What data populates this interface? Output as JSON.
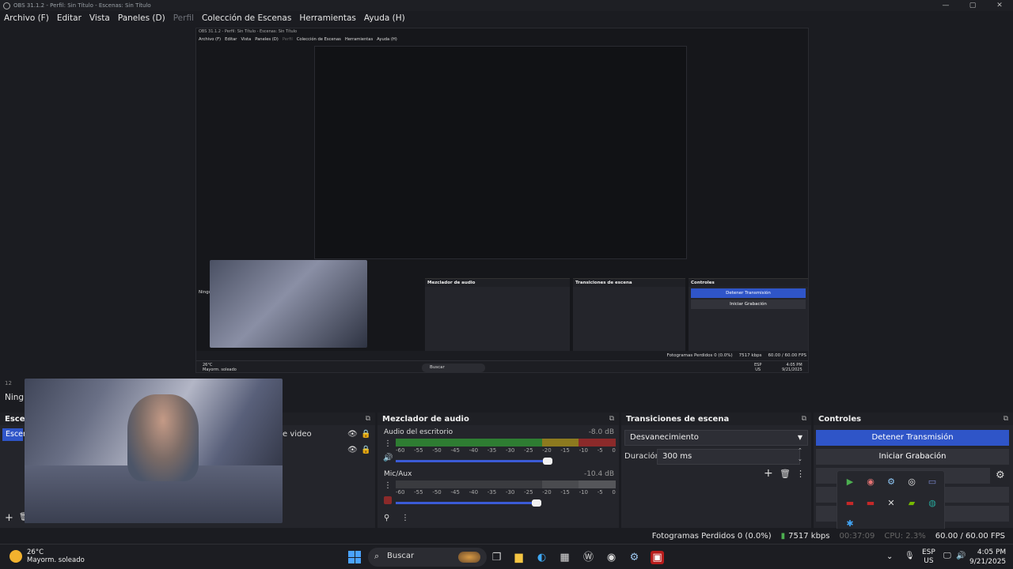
{
  "window": {
    "title": "OBS 31.1.2 - Perfil: Sin Título - Escenas: Sin Título",
    "controls": [
      "—",
      "▢",
      "✕"
    ]
  },
  "menu": [
    {
      "label": "Archivo (F)",
      "dim": false
    },
    {
      "label": "Editar",
      "dim": false
    },
    {
      "label": "Vista",
      "dim": false
    },
    {
      "label": "Paneles (D)",
      "dim": false
    },
    {
      "label": "Perfil",
      "dim": true
    },
    {
      "label": "Colección de Escenas",
      "dim": false
    },
    {
      "label": "Herramientas",
      "dim": false
    },
    {
      "label": "Ayuda (H)",
      "dim": false
    }
  ],
  "nested": {
    "title": "OBS 31.1.2 - Perfil: Sin Título - Escenas: Sin Título",
    "menu": [
      "Archivo (F)",
      "Editar",
      "Vista",
      "Paneles (D)",
      "Perfil",
      "Colección de Escenas",
      "Herramientas",
      "Ayuda (H)"
    ],
    "mixer_title": "Mezclador de audio",
    "transitions_title": "Transiciones de escena",
    "controls_title": "Controles",
    "stop_stream": "Detener Transmisión",
    "start_record": "Iniciar Grabación",
    "status": "Fotogramas Perdidos 0 (0.0%)",
    "kbps": "7517 kbps",
    "fps": "60.00 / 60.00 FPS",
    "weather_temp": "26°C",
    "weather_desc": "Mayorm. soleado",
    "search": "Buscar",
    "lang": "ESP",
    "region": "US",
    "time": "4:05 PM",
    "date": "9/21/2025",
    "cut_label": "Ningu"
  },
  "scene_bar": "12",
  "no_selection": "Ningu",
  "scenes": {
    "title": "Escen",
    "item": "Escen",
    "source_label": "e video"
  },
  "mixer": {
    "title": "Mezclador de audio",
    "tracks": [
      {
        "name": "Audio del escritorio",
        "db": "-8.0 dB",
        "volume": 0.69
      },
      {
        "name": "Mic/Aux",
        "db": "-10.4 dB",
        "volume": 0.64
      }
    ],
    "scale": [
      "-60",
      "-55",
      "-50",
      "-45",
      "-40",
      "-35",
      "-30",
      "-25",
      "-20",
      "-15",
      "-10",
      "-5",
      "0"
    ]
  },
  "transitions": {
    "title": "Transiciones de escena",
    "selected": "Desvanecimiento",
    "duration_label": "Duración",
    "duration_value": "300 ms"
  },
  "controls": {
    "title": "Controles",
    "stop_stream": "Detener Transmisión",
    "start_record": "Iniciar Grabación"
  },
  "status": {
    "dropped": "Fotogramas Perdidos 0 (0.0%)",
    "kbps": "7517 kbps",
    "rec_time": "00:37:09",
    "cpu": "CPU: 2.3%",
    "fps": "60.00 / 60.00 FPS"
  },
  "taskbar": {
    "weather_temp": "26°C",
    "weather_desc": "Mayorm. soleado",
    "search": "Buscar",
    "lang": "ESP",
    "region": "US",
    "time": "4:05 PM",
    "date": "9/21/2025"
  },
  "colors": {
    "accent": "#2f55c8",
    "meter_green": "#2e7d32",
    "meter_yellow": "#8d7a1f",
    "meter_red": "#8b2a2a",
    "panel": "#24252b"
  }
}
